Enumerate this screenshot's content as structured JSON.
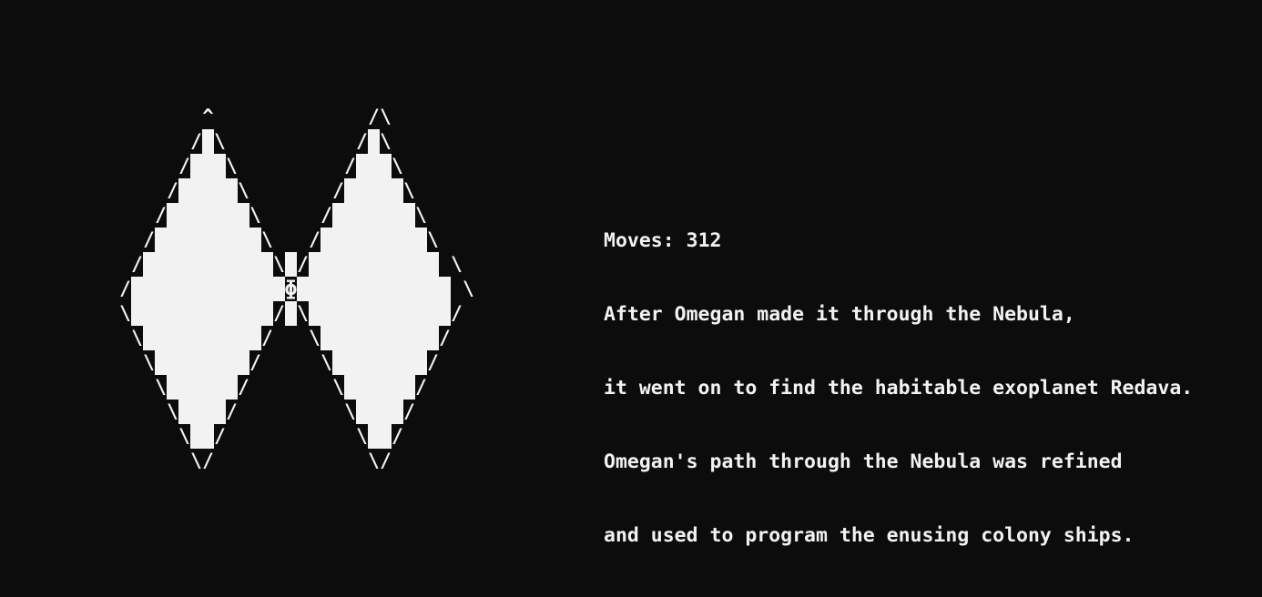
{
  "game": {
    "moves_label": "Moves:",
    "moves": 312,
    "message_lines": [
      "After Omegan made it through the Nebula,",
      "it went on to find the habitable exoplanet Redava.",
      "Omegan's path through the Nebula was refined",
      "and used to program the enusing colony ships."
    ],
    "ship_glyph": "ɸ"
  },
  "map_rows": [
    "       ^             /\\",
    "      /X\\           /X\\",
    "     /XXX\\         /XXX\\",
    "    /XXXXX\\       /XXXXX\\",
    "   /XXXXXXX\\     /XXXXXXX\\",
    "  /XXXXXXXXX\\   /XXXXXXXXX\\",
    " /XXXXXXXXXXX\\X/XXXXXXXXXXX \\",
    "/XXXXXXXXXXXXXɸXXXXXXXXXXXXX \\",
    "\\XXXXXXXXXXXX/X\\XXXXXXXXXXXX/",
    " \\XXXXXXXXXX/   \\XXXXXXXXXX/",
    "  \\XXXXXXXX/     \\XXXXXXXX/",
    "   \\XXXXXX/       \\XXXXXX/",
    "    \\XXXX/         \\XXXX/",
    "     \\XX/           \\XX/",
    "      \\/             \\/"
  ]
}
